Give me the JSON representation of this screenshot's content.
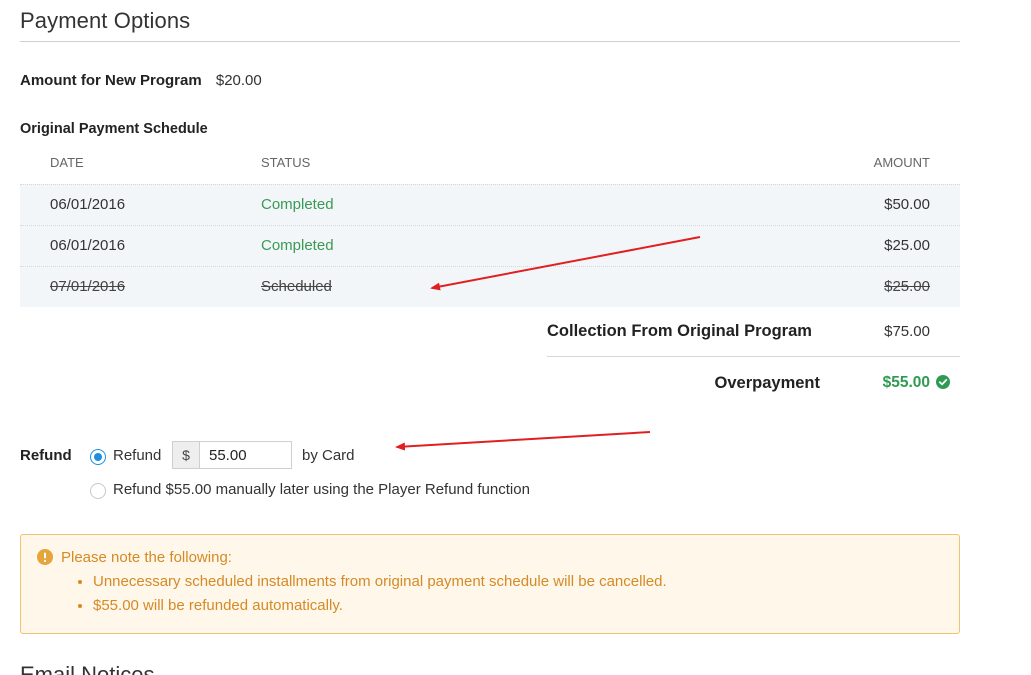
{
  "page": {
    "title": "Payment Options",
    "next_section_title": "Email Notices"
  },
  "amount_new_program": {
    "label": "Amount for New Program",
    "value": "$20.00"
  },
  "schedule": {
    "title": "Original Payment Schedule",
    "headers": {
      "date": "DATE",
      "status": "STATUS",
      "amount": "AMOUNT"
    },
    "rows": [
      {
        "date": "06/01/2016",
        "status": "Completed",
        "amount": "$50.00",
        "cancelled": false
      },
      {
        "date": "06/01/2016",
        "status": "Completed",
        "amount": "$25.00",
        "cancelled": false
      },
      {
        "date": "07/01/2016",
        "status": "Scheduled",
        "amount": "$25.00",
        "cancelled": true
      }
    ]
  },
  "collection": {
    "label": "Collection From Original Program",
    "value": "$75.00"
  },
  "overpayment": {
    "label": "Overpayment",
    "value": "$55.00",
    "icon": "check-circle-icon",
    "color": "#2f9a51"
  },
  "refund": {
    "label": "Refund",
    "option1_label": "Refund",
    "currency_prefix": "$",
    "amount_value": "55.00",
    "by_card": "by Card",
    "option2_label": "Refund $55.00 manually later using the Player Refund function",
    "selected": "option1"
  },
  "notice": {
    "icon": "exclamation-circle-icon",
    "title": "Please note the following:",
    "items": [
      "Unnecessary scheduled installments from original payment schedule will be cancelled.",
      "$55.00 will be refunded automatically."
    ],
    "color": "#d58a25",
    "background": "#fff7ea"
  },
  "annotations": {
    "arrow_color": "#e02020"
  }
}
